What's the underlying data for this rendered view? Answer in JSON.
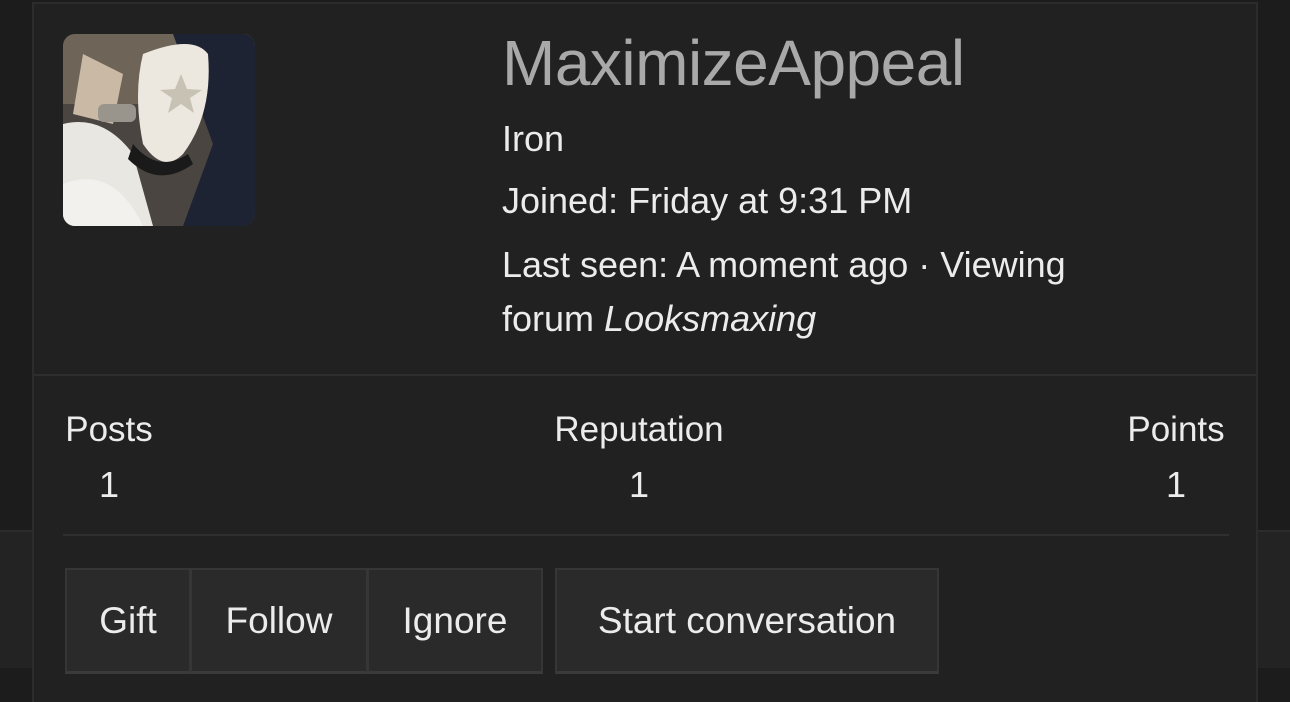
{
  "profile": {
    "username": "MaximizeAppeal",
    "rank": "Iron",
    "joined_label": "Joined:",
    "joined_value": "Friday at 9:31 PM",
    "last_seen_label": "Last seen:",
    "last_seen_value": "A moment ago · Viewing",
    "last_seen_forum_prefix": "forum",
    "last_seen_forum_name": "Looksmaxing",
    "avatar_icon": "user-avatar-photo"
  },
  "stats": {
    "posts_label": "Posts",
    "posts_value": "1",
    "reputation_label": "Reputation",
    "reputation_value": "1",
    "points_label": "Points",
    "points_value": "1"
  },
  "actions": {
    "gift_label": "Gift",
    "follow_label": "Follow",
    "ignore_label": "Ignore",
    "start_conversation_label": "Start conversation"
  },
  "colors": {
    "background": "#1c1c1c",
    "card": "#212121",
    "button": "#2a2a2a",
    "username": "#a9a9a9",
    "text": "#ececec"
  }
}
